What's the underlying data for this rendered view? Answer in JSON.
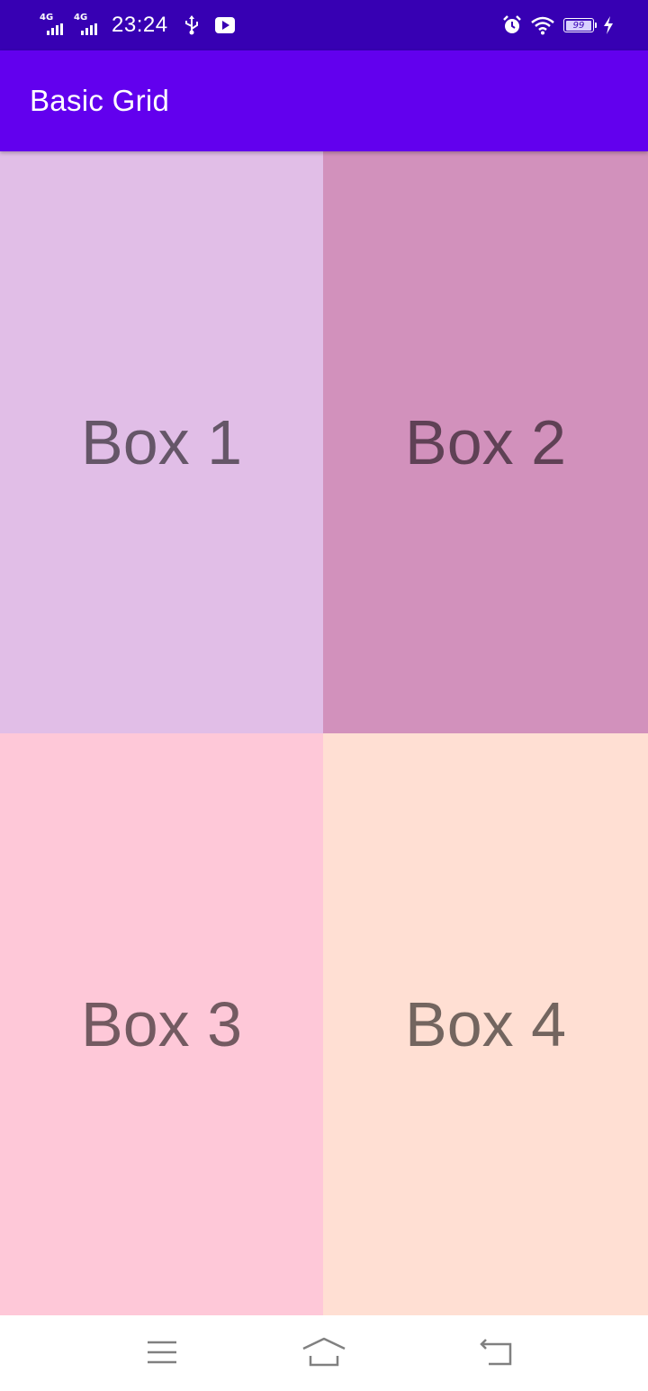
{
  "status_bar": {
    "network_1": "4G",
    "network_2": "4G",
    "time": "23:24",
    "battery": "99",
    "icons": [
      "signal-icon",
      "signal-icon",
      "usb-icon",
      "play-icon",
      "alarm-icon",
      "wifi-icon",
      "battery-icon",
      "charging-icon"
    ]
  },
  "app_bar": {
    "title": "Basic Grid",
    "color": "#6200ee"
  },
  "grid": {
    "boxes": [
      {
        "label": "Box 1",
        "color": "#e1bee7"
      },
      {
        "label": "Box 2",
        "color": "#d291bc"
      },
      {
        "label": "Box 3",
        "color": "#fec8d8"
      },
      {
        "label": "Box 4",
        "color": "#ffdfd3"
      }
    ]
  },
  "nav_bar": {
    "icons": [
      "menu-icon",
      "home-icon",
      "back-icon"
    ]
  }
}
